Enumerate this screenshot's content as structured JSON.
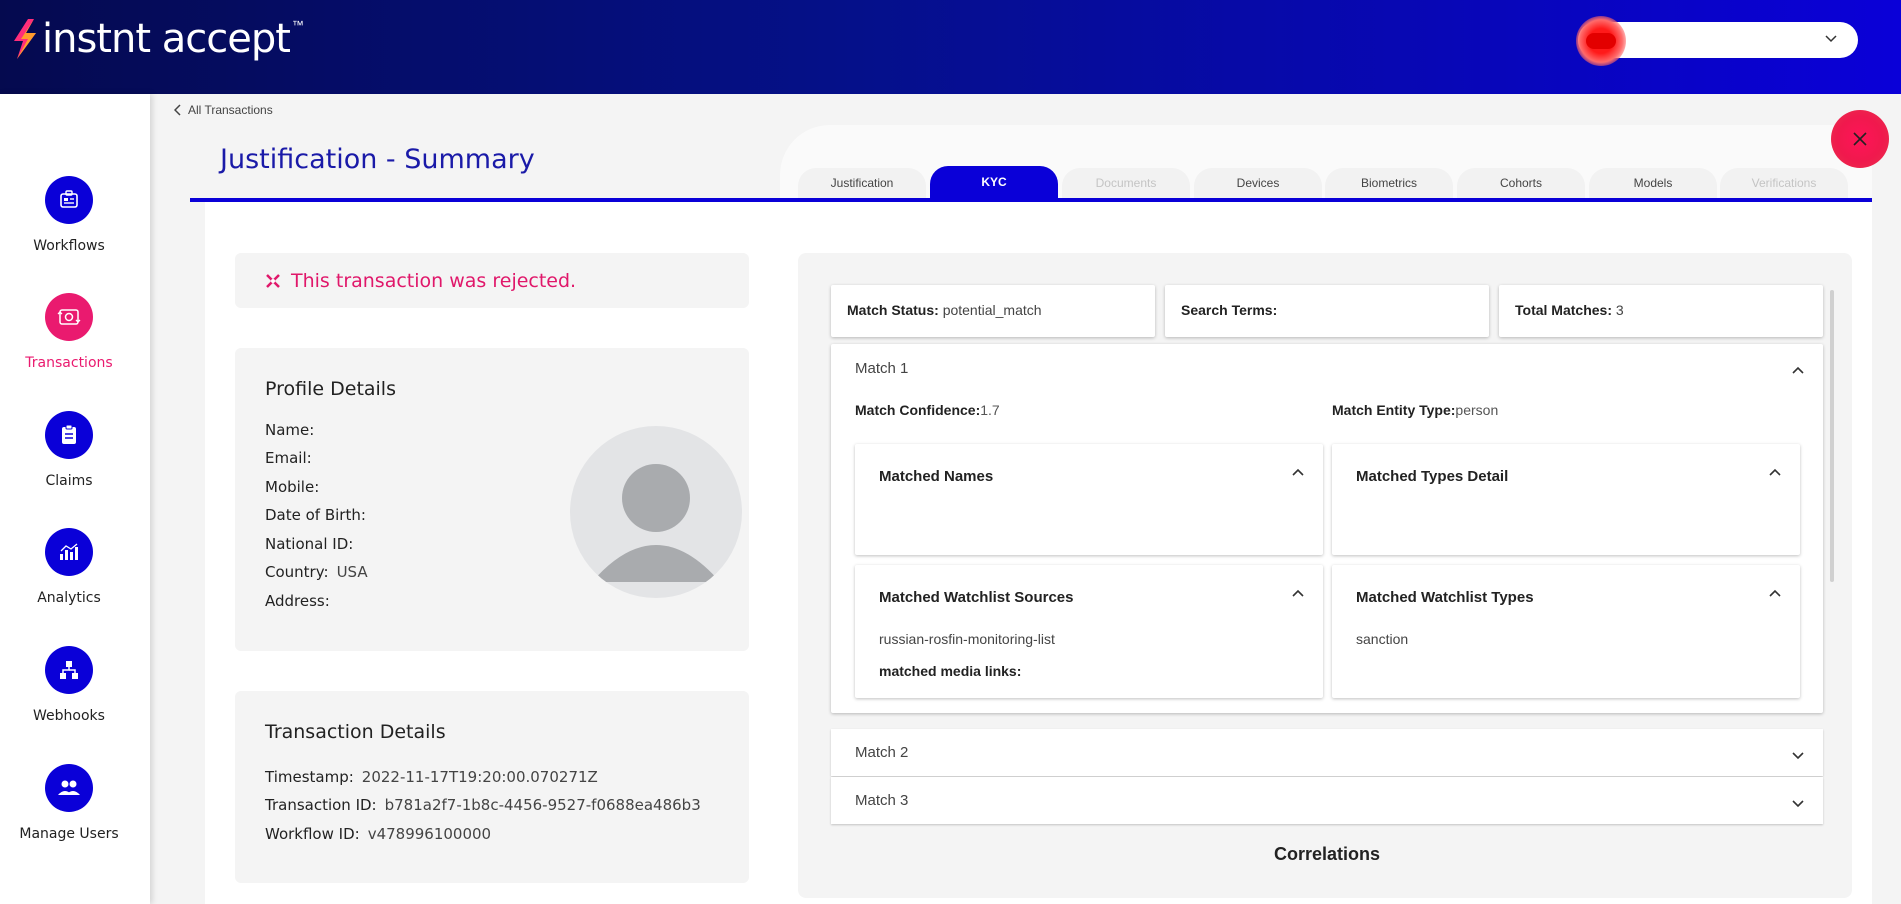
{
  "header": {
    "logo_text": "instnt accept",
    "logo_tm": "™",
    "user_select_value": ""
  },
  "sidebar": {
    "items": [
      {
        "label": "Workflows",
        "icon": "workflows-icon"
      },
      {
        "label": "Transactions",
        "icon": "transactions-icon",
        "active": true
      },
      {
        "label": "Claims",
        "icon": "claims-icon"
      },
      {
        "label": "Analytics",
        "icon": "analytics-icon"
      },
      {
        "label": "Webhooks",
        "icon": "webhooks-icon"
      },
      {
        "label": "Manage Users",
        "icon": "users-icon"
      }
    ]
  },
  "breadcrumb": "All Transactions",
  "page_title": "Justification - Summary",
  "tabs": [
    {
      "label": "Justification"
    },
    {
      "label": "KYC",
      "active": true
    },
    {
      "label": "Documents",
      "disabled": true
    },
    {
      "label": "Devices"
    },
    {
      "label": "Biometrics"
    },
    {
      "label": "Cohorts"
    },
    {
      "label": "Models"
    },
    {
      "label": "Verifications",
      "disabled": true
    }
  ],
  "status": {
    "message": "This transaction was rejected."
  },
  "profile": {
    "title": "Profile Details",
    "fields": [
      {
        "label": "Name:",
        "value": ""
      },
      {
        "label": "Email:",
        "value": ""
      },
      {
        "label": "Mobile:",
        "value": ""
      },
      {
        "label": "Date of Birth:",
        "value": ""
      },
      {
        "label": "National ID:",
        "value": ""
      },
      {
        "label": "Country:",
        "value": "USA"
      },
      {
        "label": "Address:",
        "value": ""
      }
    ]
  },
  "transaction": {
    "title": "Transaction Details",
    "fields": [
      {
        "label": "Timestamp:",
        "value": "2022-11-17T19:20:00.070271Z"
      },
      {
        "label": "Transaction ID:",
        "value": "b781a2f7-1b8c-4456-9527-f0688ea486b3"
      },
      {
        "label": "Workflow ID:",
        "value": "v478996100000"
      }
    ]
  },
  "kyc": {
    "match_status_label": "Match Status:",
    "match_status_value": "potential_match",
    "search_terms_label": "Search Terms:",
    "search_terms_value": "",
    "total_matches_label": "Total Matches:",
    "total_matches_value": "3",
    "matches": [
      {
        "title": "Match 1",
        "confidence_label": "Match Confidence:",
        "confidence_value": "1.7",
        "entity_type_label": "Match Entity Type:",
        "entity_type_value": "person",
        "matched_names_title": "Matched Names",
        "matched_types_detail_title": "Matched Types Detail",
        "watchlist_sources_title": "Matched Watchlist Sources",
        "watchlist_sources_value": "russian-rosfin-monitoring-list",
        "media_links_label": "matched media links:",
        "watchlist_types_title": "Matched Watchlist Types",
        "watchlist_types_value": "sanction"
      },
      {
        "title": "Match 2"
      },
      {
        "title": "Match 3"
      }
    ],
    "correlations_title": "Correlations"
  },
  "colors": {
    "primary": "#0a00d8",
    "accent": "#ea1a6f",
    "title": "#1a1aa8"
  }
}
